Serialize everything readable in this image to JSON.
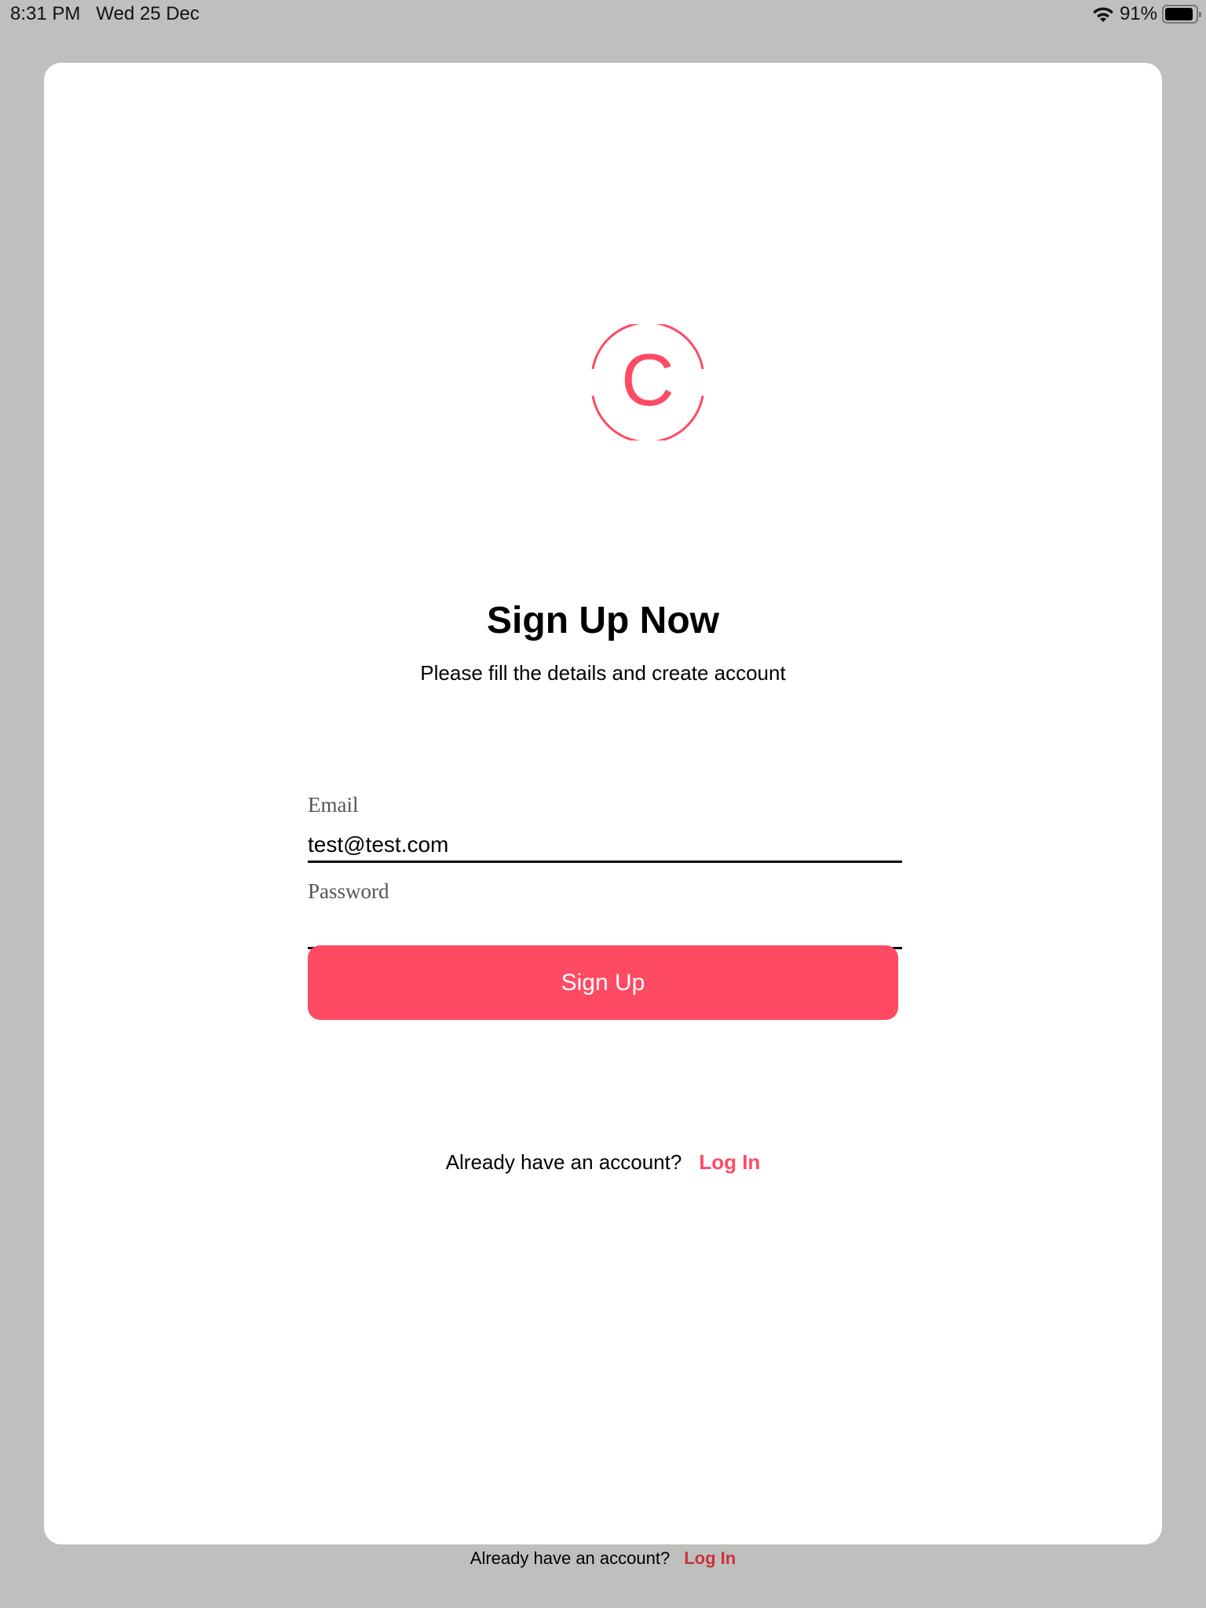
{
  "status_bar": {
    "time": "8:31 PM",
    "date": "Wed 25 Dec",
    "battery": "91%",
    "battery_level": 0.91,
    "icons": [
      "wifi-icon",
      "battery-icon"
    ]
  },
  "logo": {
    "letter": "C",
    "color": "#ff4a64"
  },
  "title": "Sign Up Now",
  "subtitle": "Please fill the details and create account",
  "form": {
    "email_label": "Email",
    "email_value": "test@test.com",
    "password_label": "Password",
    "password_value": ""
  },
  "button": {
    "label": "Sign Up",
    "color": "#ff4a64"
  },
  "footer": {
    "prompt": "Already have an account?",
    "link": "Log In"
  },
  "bottom": {
    "prompt": "Already have an account?",
    "link": "Log In"
  }
}
